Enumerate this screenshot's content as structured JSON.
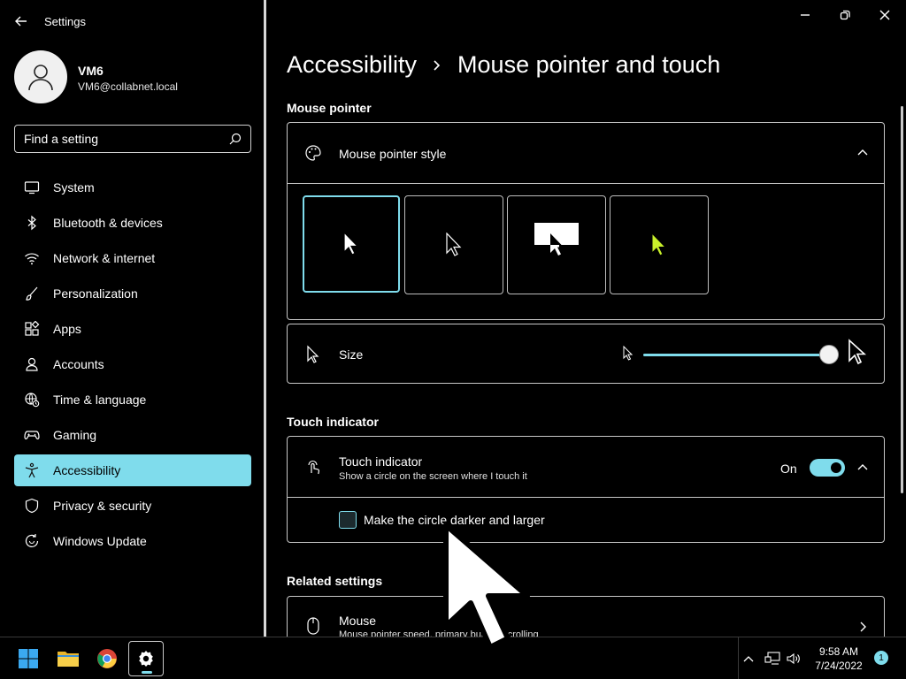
{
  "window": {
    "app_title": "Settings"
  },
  "user": {
    "name": "VM6",
    "email": "VM6@collabnet.local"
  },
  "search": {
    "placeholder": "Find a setting"
  },
  "nav": {
    "items": [
      {
        "label": "System",
        "icon": "monitor-icon"
      },
      {
        "label": "Bluetooth & devices",
        "icon": "bluetooth-icon"
      },
      {
        "label": "Network & internet",
        "icon": "wifi-icon"
      },
      {
        "label": "Personalization",
        "icon": "brush-icon"
      },
      {
        "label": "Apps",
        "icon": "apps-icon"
      },
      {
        "label": "Accounts",
        "icon": "person-icon"
      },
      {
        "label": "Time & language",
        "icon": "globe-clock-icon"
      },
      {
        "label": "Gaming",
        "icon": "gamepad-icon"
      },
      {
        "label": "Accessibility",
        "icon": "accessibility-icon",
        "active": true
      },
      {
        "label": "Privacy & security",
        "icon": "shield-icon"
      },
      {
        "label": "Windows Update",
        "icon": "update-icon"
      }
    ]
  },
  "header": {
    "parent": "Accessibility",
    "separator": "›",
    "current": "Mouse pointer and touch"
  },
  "mouse_pointer": {
    "section_title": "Mouse pointer",
    "style_label": "Mouse pointer style",
    "styles": [
      "White",
      "Black",
      "Inverted",
      "Custom"
    ],
    "selected_style": "White",
    "size_label": "Size",
    "size_value_fraction": 1.0
  },
  "touch": {
    "section_title": "Touch indicator",
    "label": "Touch indicator",
    "description": "Show a circle on the screen where I touch it",
    "state_text": "On",
    "enabled": true,
    "darker_label": "Make the circle darker and larger",
    "darker_checked": false
  },
  "related": {
    "section_title": "Related settings",
    "mouse_label": "Mouse",
    "mouse_description": "Mouse pointer speed, primary button, scrolling"
  },
  "taskbar": {
    "apps": [
      "start-icon",
      "file-explorer-icon",
      "chrome-icon",
      "settings-icon"
    ],
    "time": "9:58 AM",
    "date": "7/24/2022",
    "notification_count": "1"
  },
  "colors": {
    "accent": "#7fdcec",
    "custom_pointer": "#c8f02a"
  }
}
